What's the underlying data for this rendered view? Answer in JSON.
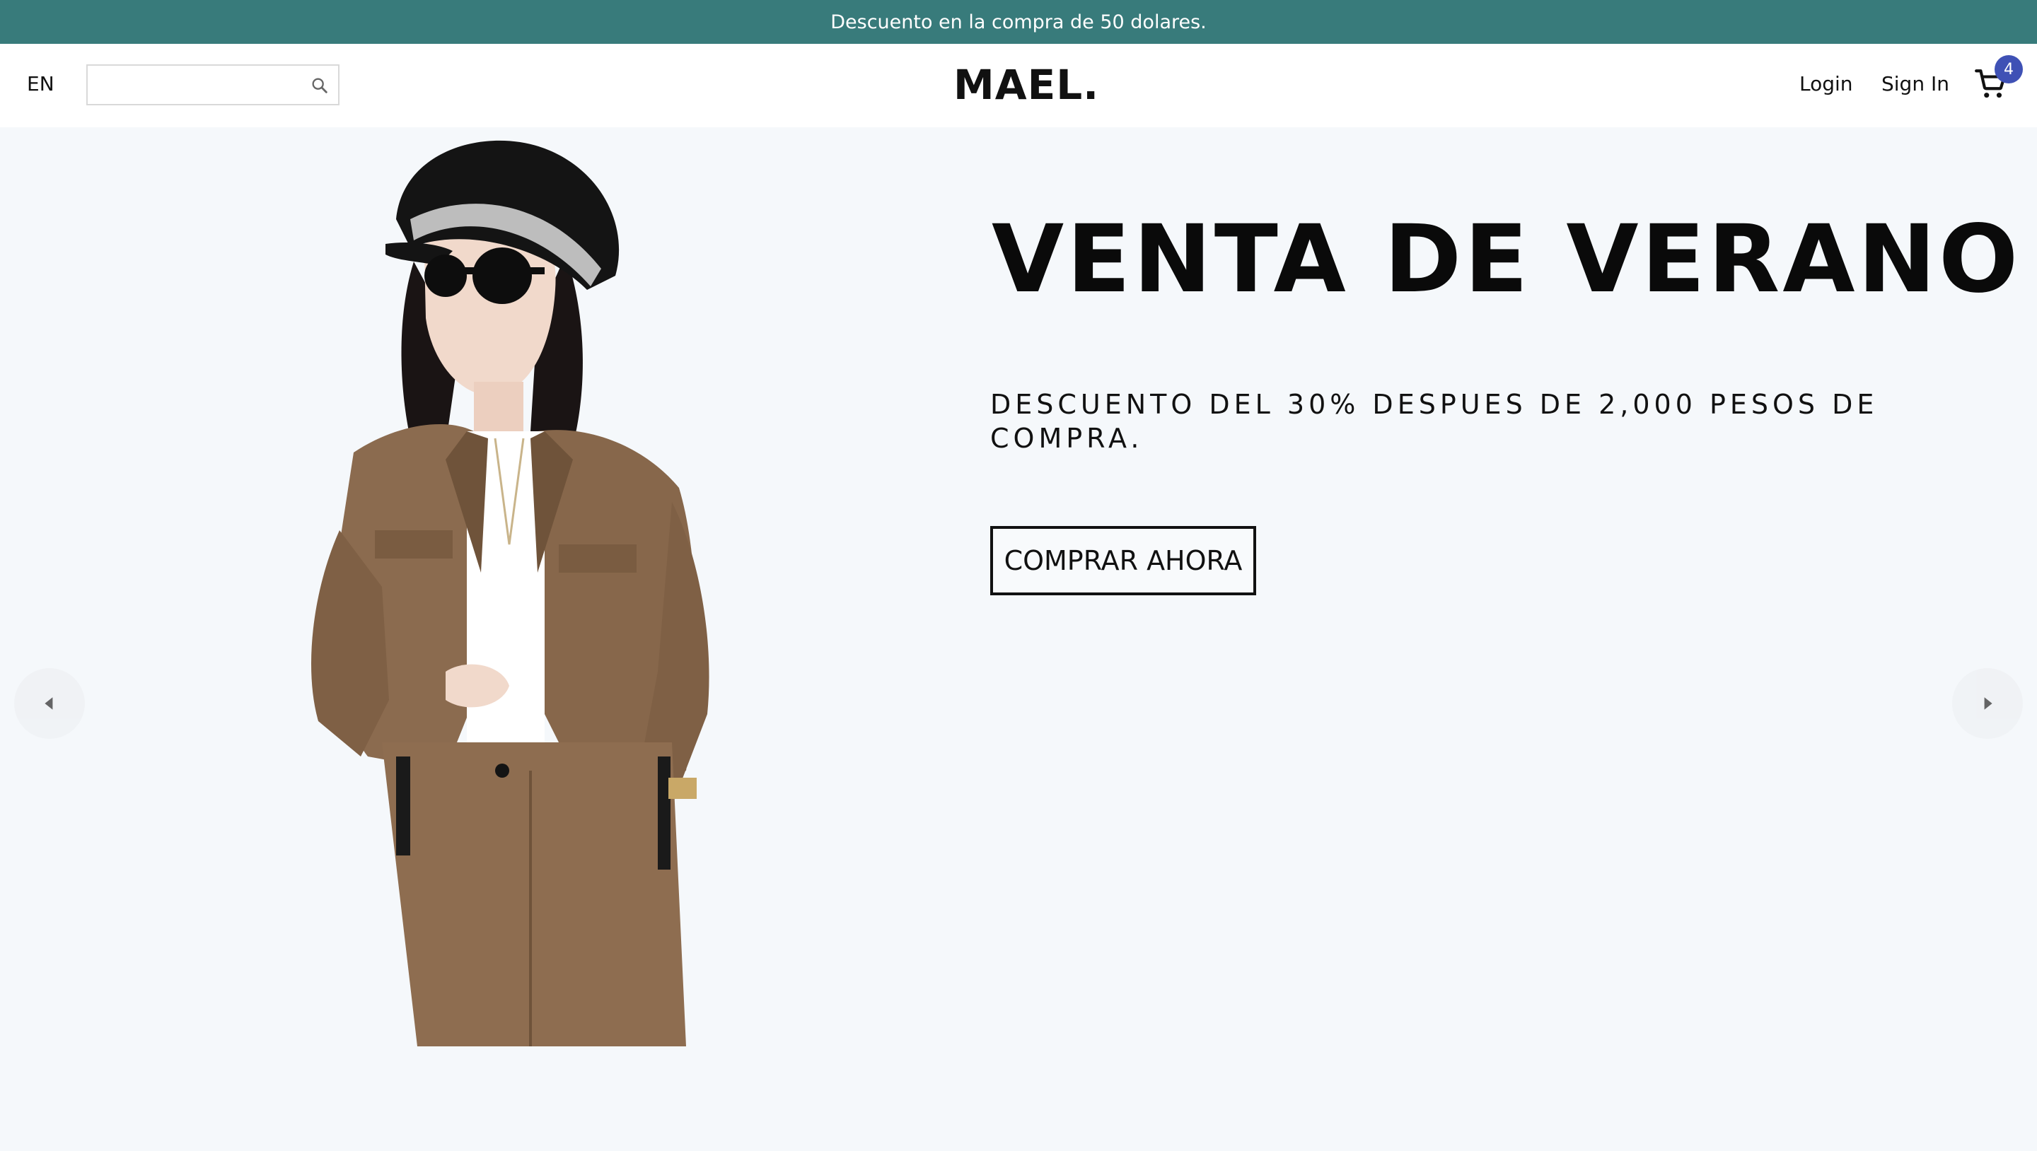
{
  "announcement": {
    "text": "Descuento en la compra de 50 dolares."
  },
  "navbar": {
    "language": "EN",
    "search": {
      "value": "",
      "placeholder": "",
      "icon": "search-icon"
    },
    "logo": "MAEL.",
    "links": {
      "login": "Login",
      "sign_in": "Sign In"
    },
    "cart": {
      "icon": "cart-icon",
      "count": "4"
    }
  },
  "slider": {
    "left_arrow_icon": "arrow-left-icon",
    "right_arrow_icon": "arrow-right-icon",
    "slide": {
      "title": "VENTA DE VERANO",
      "description": "DESCUENTO DEL 30% DESPUES DE 2,000 PESOS DE COMPRA.",
      "button_label": "COMPRAR AHORA",
      "image": "model-in-brown-jacket-and-black-cap"
    }
  },
  "colors": {
    "announcement_bg": "#387b7b",
    "page_bg": "#f5f8fb",
    "badge": "#3f51b5",
    "jacket": "#8b6b4f"
  }
}
